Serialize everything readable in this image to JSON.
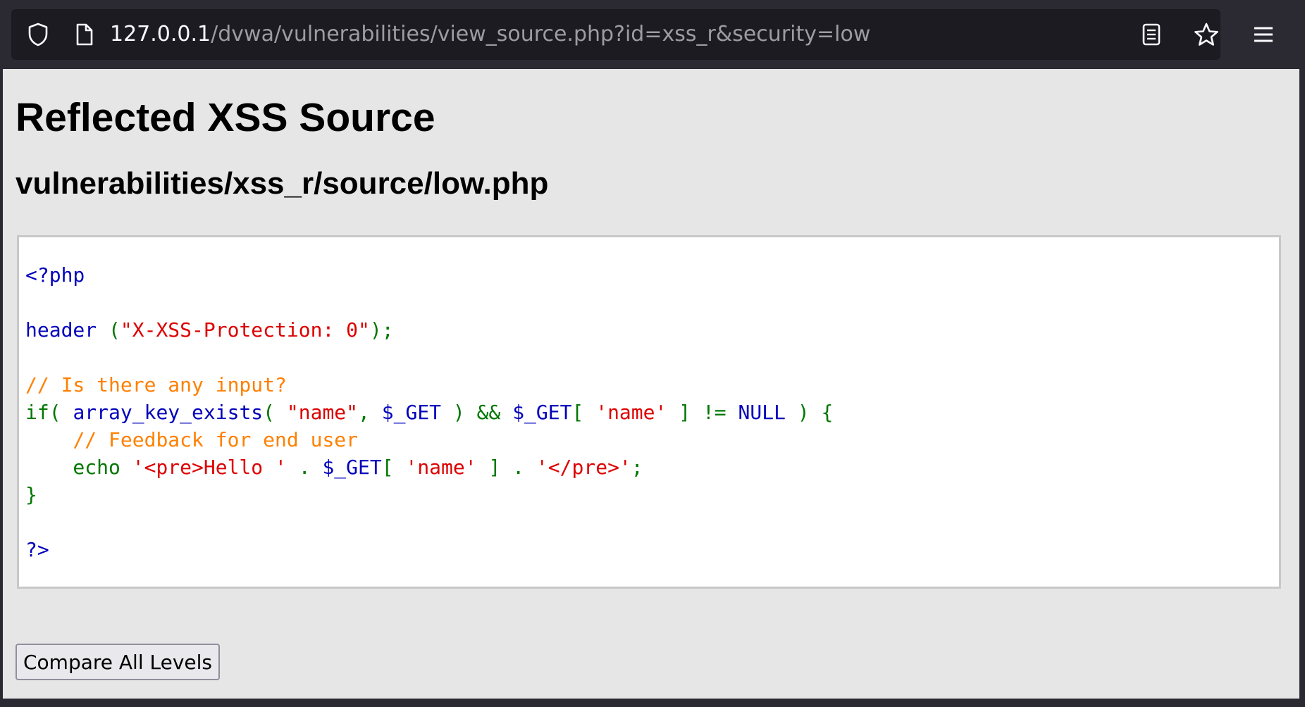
{
  "browser": {
    "url_host": "127.0.0.1",
    "url_path": "/dvwa/vulnerabilities/view_source.php?id=xss_r&security=low",
    "icons": {
      "shield": "shield-icon",
      "page": "page-icon",
      "reader": "reader-view-icon",
      "star": "bookmark-star-icon",
      "menu": "hamburger-menu-icon"
    }
  },
  "page": {
    "title": "Reflected XSS Source",
    "file_path": "vulnerabilities/xss_r/source/low.php",
    "compare_button_label": "Compare All Levels"
  },
  "code": {
    "colors": {
      "keyword": "#0000bb",
      "string": "#dd0000",
      "operator": "#007700",
      "comment": "#ff8000"
    },
    "lines": [
      [
        {
          "t": "<?php",
          "c": "keyword"
        }
      ],
      [],
      [
        {
          "t": "header ",
          "c": "keyword"
        },
        {
          "t": "(",
          "c": "operator"
        },
        {
          "t": "\"X-XSS-Protection: 0\"",
          "c": "string"
        },
        {
          "t": ");",
          "c": "operator"
        }
      ],
      [],
      [
        {
          "t": "// Is there any input?",
          "c": "comment"
        }
      ],
      [
        {
          "t": "if( ",
          "c": "operator"
        },
        {
          "t": "array_key_exists",
          "c": "keyword"
        },
        {
          "t": "( ",
          "c": "operator"
        },
        {
          "t": "\"name\"",
          "c": "string"
        },
        {
          "t": ", ",
          "c": "operator"
        },
        {
          "t": "$_GET ",
          "c": "keyword"
        },
        {
          "t": ") && ",
          "c": "operator"
        },
        {
          "t": "$_GET",
          "c": "keyword"
        },
        {
          "t": "[ ",
          "c": "operator"
        },
        {
          "t": "'name' ",
          "c": "string"
        },
        {
          "t": "] != ",
          "c": "operator"
        },
        {
          "t": "NULL ",
          "c": "keyword"
        },
        {
          "t": ") {",
          "c": "operator"
        }
      ],
      [
        {
          "t": "    ",
          "c": "operator"
        },
        {
          "t": "// Feedback for end user",
          "c": "comment"
        }
      ],
      [
        {
          "t": "    echo ",
          "c": "operator"
        },
        {
          "t": "'<pre>Hello ' ",
          "c": "string"
        },
        {
          "t": ". ",
          "c": "operator"
        },
        {
          "t": "$_GET",
          "c": "keyword"
        },
        {
          "t": "[ ",
          "c": "operator"
        },
        {
          "t": "'name' ",
          "c": "string"
        },
        {
          "t": "] . ",
          "c": "operator"
        },
        {
          "t": "'</pre>'",
          "c": "string"
        },
        {
          "t": ";",
          "c": "operator"
        }
      ],
      [
        {
          "t": "}",
          "c": "operator"
        }
      ],
      [],
      [
        {
          "t": "?>",
          "c": "keyword"
        }
      ]
    ]
  }
}
